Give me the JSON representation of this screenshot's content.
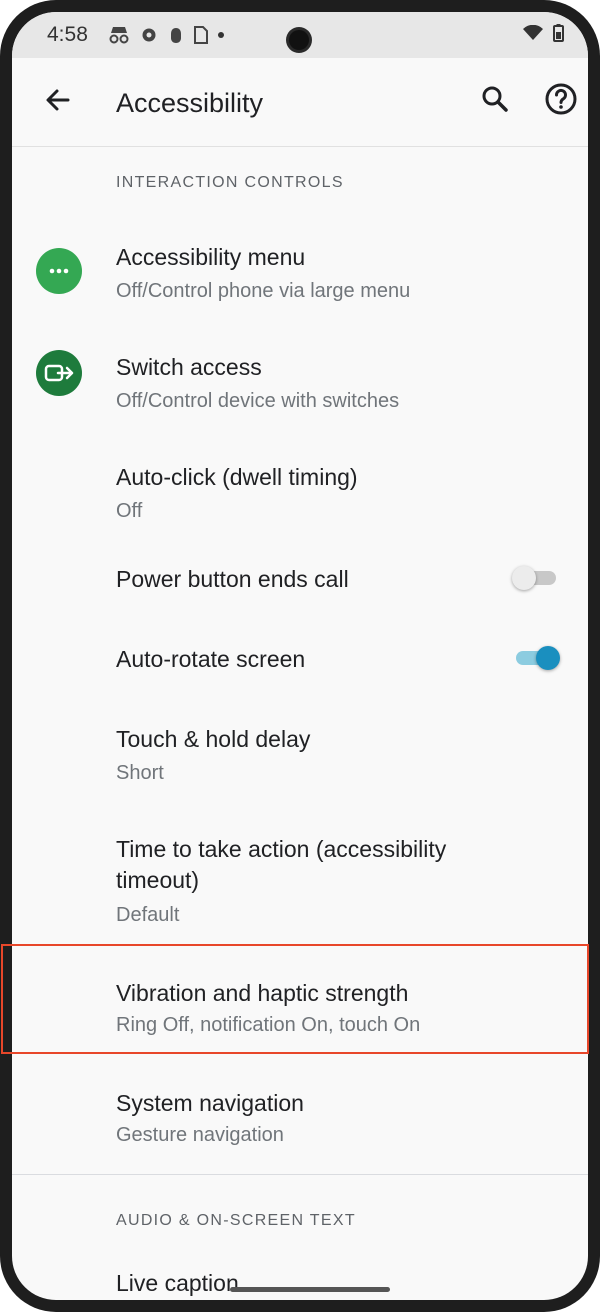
{
  "status_bar": {
    "time": "4:58"
  },
  "app_bar": {
    "title": "Accessibility",
    "back_icon": "arrow-back-icon",
    "search_icon": "search-icon",
    "help_icon": "help-icon"
  },
  "sections": {
    "interaction_controls": "INTERACTION CONTROLS",
    "audio_text": "AUDIO & ON-SCREEN TEXT"
  },
  "items": {
    "accessibility_menu": {
      "title": "Accessibility menu",
      "subtitle": "Off/Control phone via large menu"
    },
    "switch_access": {
      "title": "Switch access",
      "subtitle": "Off/Control device with switches"
    },
    "auto_click": {
      "title": "Auto-click (dwell timing)",
      "subtitle": "Off"
    },
    "power_button": {
      "title": "Power button ends call",
      "toggle_on": false
    },
    "auto_rotate": {
      "title": "Auto-rotate screen",
      "toggle_on": true
    },
    "touch_hold": {
      "title": "Touch & hold delay",
      "subtitle": "Short"
    },
    "time_to_take_action": {
      "title_line1": "Time to take action (accessibility",
      "title_line2": "timeout)",
      "subtitle": "Default"
    },
    "vibration": {
      "title": "Vibration and haptic strength",
      "subtitle": "Ring Off, notification On, touch On"
    },
    "system_navigation": {
      "title": "System navigation",
      "subtitle": "Gesture navigation"
    },
    "live_caption": {
      "title": "Live caption"
    }
  },
  "colors": {
    "accent": "#1a8fbf",
    "menu_icon_bg": "#34a853",
    "switch_icon_bg": "#1e7b3c",
    "highlight": "#e8472a"
  }
}
